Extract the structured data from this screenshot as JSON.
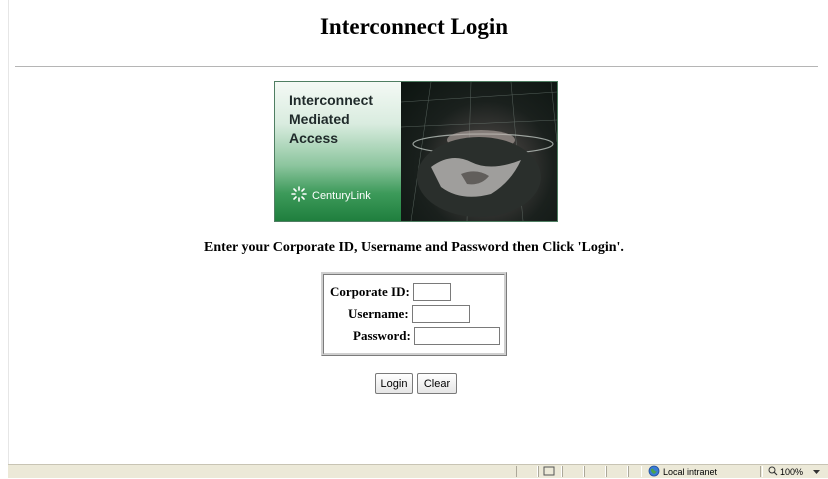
{
  "page": {
    "title": "Interconnect Login",
    "instruction": "Enter your Corporate ID, Username and Password then Click 'Login'."
  },
  "banner": {
    "line1": "Interconnect",
    "line2": "Mediated",
    "line3": "Access",
    "logo_text": "CenturyLink",
    "logo_icon": "centurylink-logo-icon",
    "colors": {
      "green_dark": "#1f7f3e",
      "green_light": "#d9ecdf"
    }
  },
  "form": {
    "corporate_id_label": "Corporate ID:",
    "corporate_id_value": "",
    "username_label": "Username:",
    "username_value": "",
    "password_label": "Password:",
    "password_value": ""
  },
  "buttons": {
    "login": "Login",
    "clear": "Clear"
  },
  "statusbar": {
    "zone": "Local intranet",
    "zone_icon": "globe-icon",
    "zoom": "100%",
    "zoom_icon": "magnifier-icon",
    "zoom_dropdown_icon": "chevron-down-icon"
  }
}
